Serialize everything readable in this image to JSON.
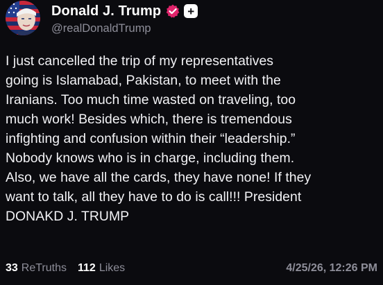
{
  "author": {
    "display_name": "Donald J. Trump",
    "handle": "@realDonaldTrump",
    "verified_icon": "verified-badge-icon",
    "verified_color": "#e0246b",
    "plus_icon": "plus-icon",
    "plus_glyph": "+"
  },
  "post": {
    "lines": [
      "I just cancelled the trip of my representatives",
      "going is Islamabad, Pakistan, to meet with the",
      "Iranians. Too much time wasted on traveling, too",
      "much work! Besides which, there is tremendous",
      "infighting and confusion within their “leadership.”",
      "Nobody knows who is in charge, including them.",
      "Also, we have all the cards, they have none! If they",
      "want to talk, all they have to do is call!!! President",
      "DONAKD J. TRUMP"
    ]
  },
  "stats": {
    "retruths_count": "33",
    "retruths_label": "ReTruths",
    "likes_count": "112",
    "likes_label": "Likes",
    "timestamp": "4/25/26, 12:26 PM"
  },
  "colors": {
    "background": "#0b0b0f",
    "text": "#f2f2f5",
    "muted": "#8e8e99"
  }
}
